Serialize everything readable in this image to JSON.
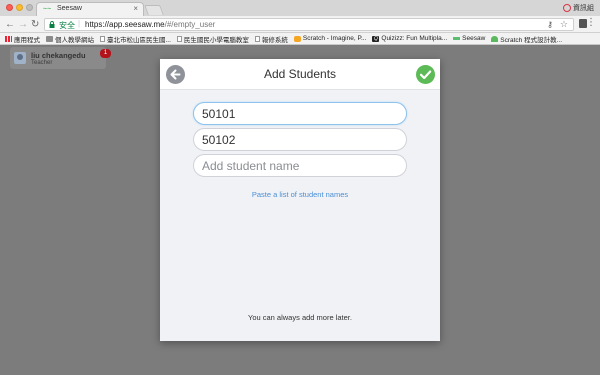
{
  "browser": {
    "tab_title": "Seesaw",
    "tab_favicon": "seesaw-favicon",
    "profile_label": "資訊組",
    "secure_label": "安全",
    "url_host": "https://app.seesaw.me",
    "url_rest": "/#/empty_user",
    "bookmarks": [
      {
        "label": "應用程式",
        "icon": "apps-grid-icon"
      },
      {
        "label": "個人教學網站",
        "icon": "folder-icon"
      },
      {
        "label": "臺北市松山區民生國...",
        "icon": "page-icon"
      },
      {
        "label": "民生國民小學電腦教室",
        "icon": "page-icon"
      },
      {
        "label": "報修系統",
        "icon": "page-icon"
      },
      {
        "label": "Scratch - Imagine, P...",
        "icon": "scratch-icon"
      },
      {
        "label": "Quizizz: Fun Multipla...",
        "icon": "quizizz-icon"
      },
      {
        "label": "Seesaw",
        "icon": "seesaw-icon"
      },
      {
        "label": "Scratch 程式設計教...",
        "icon": "scratch-cat-icon"
      }
    ]
  },
  "user": {
    "name": "liu chekangedu",
    "role": "Teacher",
    "notification_count": "1"
  },
  "modal": {
    "title": "Add Students",
    "fields": [
      {
        "value": "50101",
        "placeholder": ""
      },
      {
        "value": "50102",
        "placeholder": ""
      },
      {
        "value": "",
        "placeholder": "Add student name"
      }
    ],
    "paste_link": "Paste a list of student names",
    "footer_note": "You can always add more later."
  },
  "colors": {
    "done_green": "#5cbb56",
    "link_blue": "#4a8fd6",
    "badge_red": "#b3141c",
    "focus_blue": "#8ec1ec"
  }
}
